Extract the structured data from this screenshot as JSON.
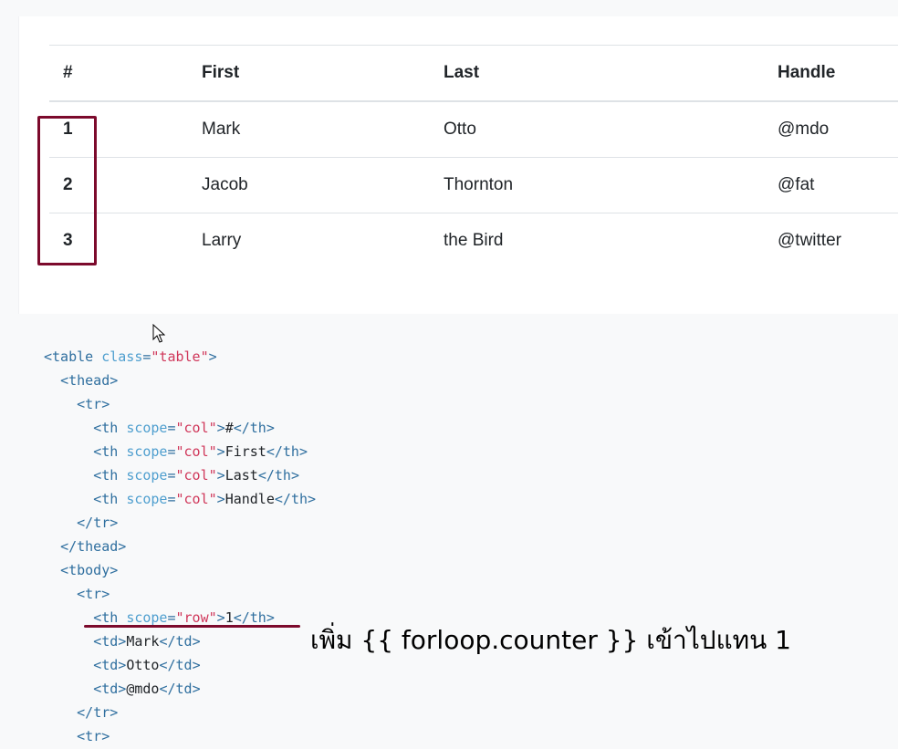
{
  "table": {
    "headers": [
      "#",
      "First",
      "Last",
      "Handle"
    ],
    "rows": [
      {
        "num": "1",
        "first": "Mark",
        "last": "Otto",
        "handle": "@mdo"
      },
      {
        "num": "2",
        "first": "Jacob",
        "last": "Thornton",
        "handle": "@fat"
      },
      {
        "num": "3",
        "first": "Larry",
        "last": "the Bird",
        "handle": "@twitter"
      }
    ]
  },
  "code": {
    "table_tag": "table",
    "attr_class": "class",
    "class_value": "\"table\"",
    "thead": "thead",
    "tbody": "tbody",
    "tr": "tr",
    "th": "th",
    "td": "td",
    "attr_scope": "scope",
    "scope_col": "\"col\"",
    "scope_row": "\"row\"",
    "col_texts": [
      "#",
      "First",
      "Last",
      "Handle"
    ],
    "row1": {
      "num": "1",
      "first": "Mark",
      "last": "Otto",
      "handle": "@mdo"
    }
  },
  "annotation": {
    "text": "เพิ่ม {{ forloop.counter }} เข้าไปแทน 1",
    "color": "#7c0a2c"
  },
  "icons": {
    "cursor": "mouse-pointer-icon"
  },
  "colors": {
    "tag": "#2f6f9f",
    "attr": "#4f9fcf",
    "string": "#d0375a",
    "highlight": "#7c0a2c"
  }
}
